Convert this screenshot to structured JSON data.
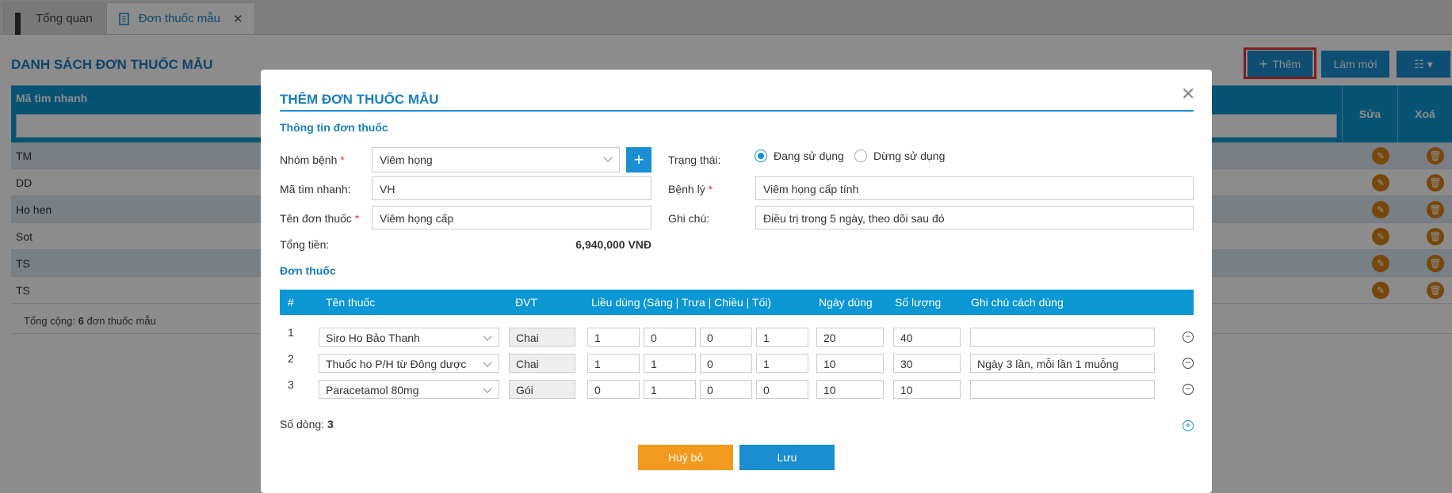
{
  "tabs": [
    {
      "label": "Tổng quan",
      "icon": "dashboard-icon"
    },
    {
      "label": "Đơn thuốc mẫu",
      "icon": "document-icon",
      "close": "✕"
    }
  ],
  "list": {
    "title": "DANH SÁCH ĐƠN THUỐC MẪU",
    "add_label": "Thêm",
    "refresh_label": "Làm mới",
    "col_code": "Mã tìm nhanh",
    "col_edit": "Sửa",
    "col_delete": "Xoá",
    "rows": [
      "TM",
      "DD",
      "Ho hen",
      "Sot",
      "TS",
      "TS"
    ],
    "total_prefix": "Tổng cộng: ",
    "total_count": "6",
    "total_suffix": " đơn thuốc mẫu"
  },
  "modal": {
    "title": "THÊM ĐƠN THUỐC MẪU",
    "close": "✕",
    "section_info": "Thông tin đơn thuốc",
    "nhom_benh_label": "Nhóm bệnh",
    "nhom_benh_value": "Viêm họng",
    "ma_label": "Mã tìm nhanh:",
    "ma_value": "VH",
    "ten_label": "Tên đơn thuốc",
    "ten_value": "Viêm họng cấp",
    "tong_label": "Tổng tiền:",
    "tong_value": "6,940,000 VNĐ",
    "trang_thai_label": "Trạng thái:",
    "status_active": "Đang sử dụng",
    "status_inactive": "Dừng sử dụng",
    "benh_ly_label": "Bệnh lý",
    "benh_ly_value": "Viêm họng cấp tính",
    "ghi_chu_label": "Ghi chú:",
    "ghi_chu_value": "Điều trị trong 5 ngày, theo dõi sau đó",
    "section_rx": "Đơn thuốc",
    "rx_headers": [
      "#",
      "Tên thuốc",
      "ĐVT",
      "Liều dùng (Sáng | Trưa | Chiều | Tối)",
      "Ngày dùng",
      "Số lượng",
      "Ghi chú cách dùng"
    ],
    "rx_rows": [
      {
        "n": "1",
        "name": "Siro Ho Bảo Thanh",
        "unit": "Chai",
        "d1": "1",
        "d2": "0",
        "d3": "0",
        "d4": "1",
        "days": "20",
        "qty": "40",
        "note": ""
      },
      {
        "n": "2",
        "name": "Thuốc ho P/H từ Đông dược",
        "unit": "Chai",
        "d1": "1",
        "d2": "1",
        "d3": "0",
        "d4": "1",
        "days": "10",
        "qty": "30",
        "note": "Ngày 3 lần, mỗi lần 1 muỗng"
      },
      {
        "n": "3",
        "name": "Paracetamol 80mg",
        "unit": "Gói",
        "d1": "0",
        "d2": "1",
        "d3": "0",
        "d4": "0",
        "days": "10",
        "qty": "10",
        "note": ""
      }
    ],
    "so_dong_label": "Số dòng:",
    "so_dong_value": "3",
    "cancel_label": "Huỷ bỏ",
    "save_label": "Lưu"
  },
  "colors": {
    "accent": "#1a8ed1",
    "header": "#0b97d3",
    "cancel": "#f39a1e",
    "highlight": "#e53935"
  }
}
